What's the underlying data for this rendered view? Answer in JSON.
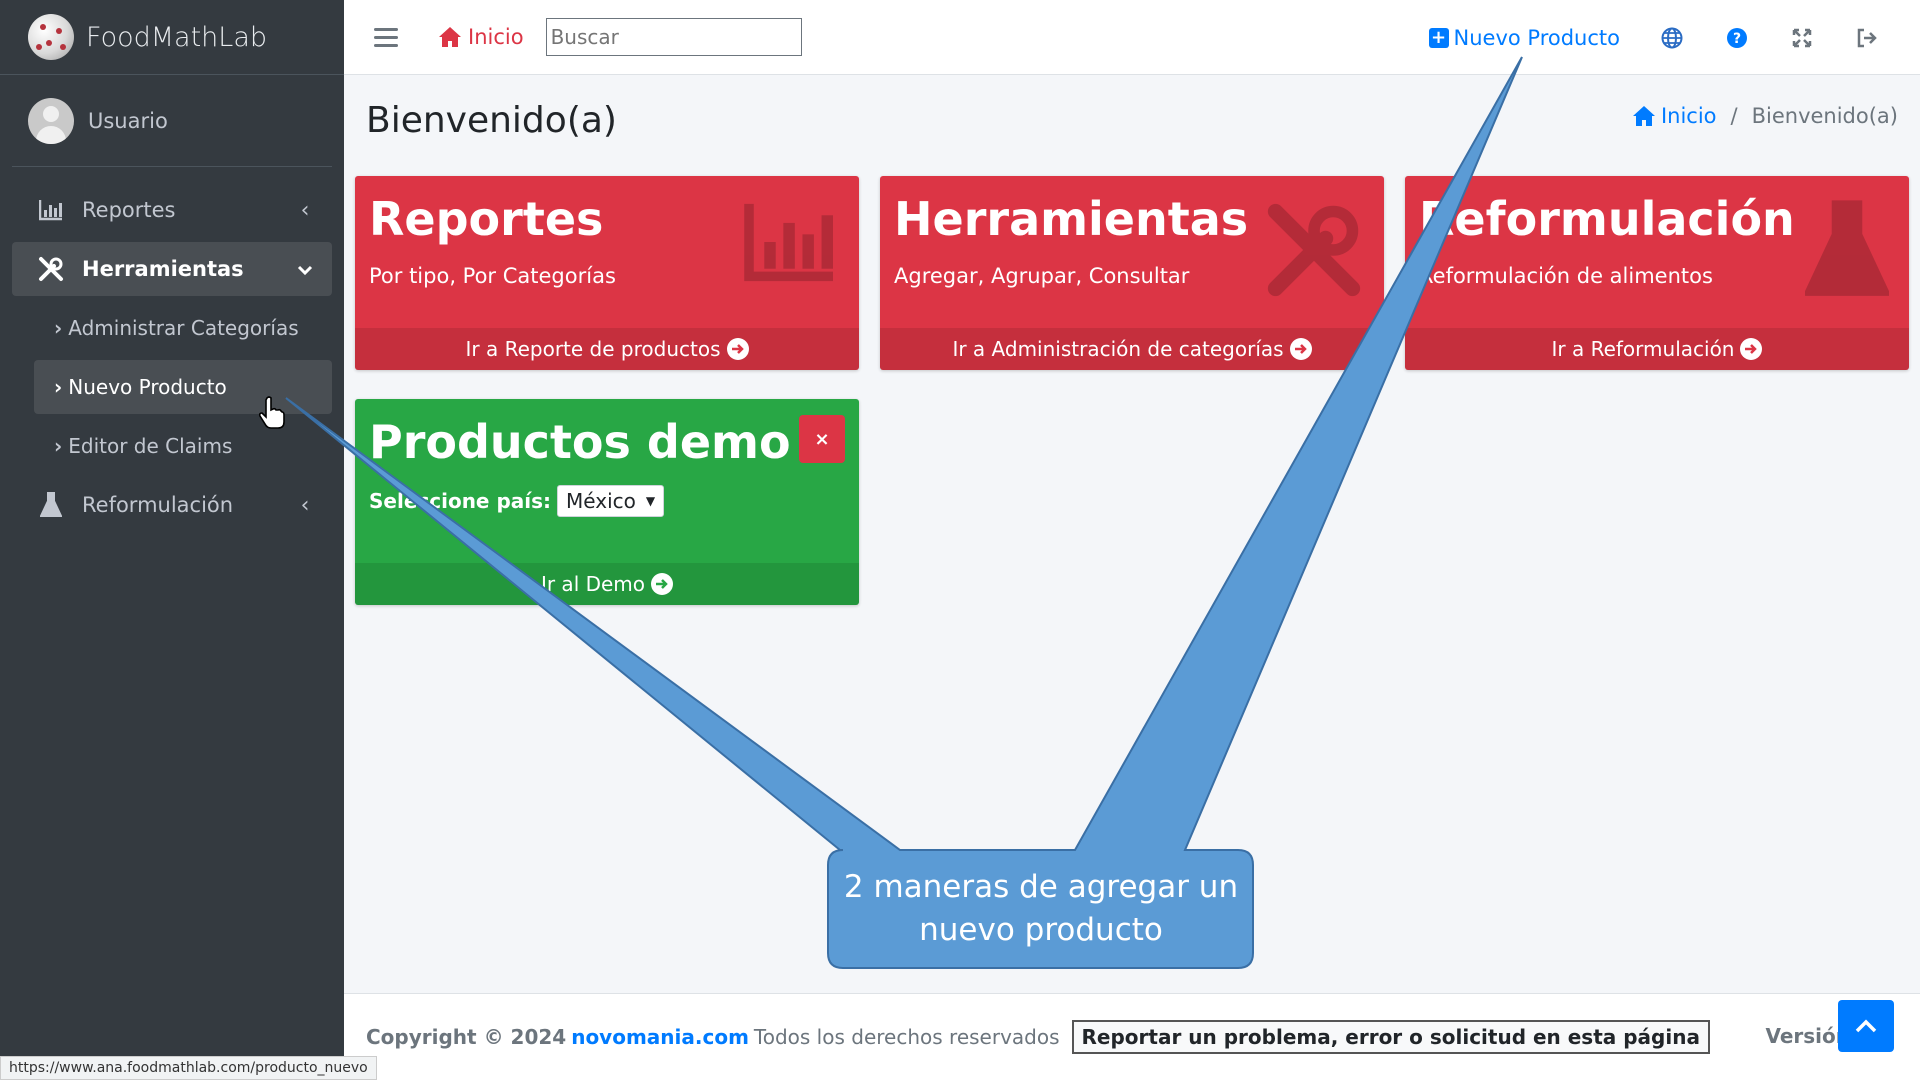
{
  "brand": {
    "name": "FoodMathLab"
  },
  "user": {
    "name": "Usuario"
  },
  "sidebar": {
    "items": [
      {
        "label": "Reportes",
        "icon": "bar-chart-icon",
        "arrow": "‹"
      },
      {
        "label": "Herramientas",
        "icon": "tools-icon",
        "arrow": "⌄"
      },
      {
        "label": "Reformulación",
        "icon": "flask-icon",
        "arrow": "‹"
      }
    ],
    "subitems": [
      {
        "label": "Administrar Categorías"
      },
      {
        "label": "Nuevo Producto"
      },
      {
        "label": "Editor de Claims"
      }
    ]
  },
  "header": {
    "home_label": "Inicio",
    "search_placeholder": "Buscar",
    "new_product_label": "Nuevo Producto"
  },
  "page": {
    "title": "Bienvenido(a)",
    "breadcrumb": {
      "home": "Inicio",
      "separator": "/",
      "current": "Bienvenido(a)"
    }
  },
  "cards": [
    {
      "title": "Reportes",
      "subtitle": "Por tipo, Por Categorías",
      "footer": "Ir a Reporte de productos"
    },
    {
      "title": "Herramientas",
      "subtitle": "Agregar, Agrupar, Consultar",
      "footer": "Ir a Administración de categorías"
    },
    {
      "title": "Reformulación",
      "subtitle": "Reformulación de alimentos",
      "footer": "Ir a Reformulación"
    }
  ],
  "demo_card": {
    "title": "Productos demo",
    "country_label": "Seleccione país:",
    "country_value": "México",
    "footer": "Ir al Demo",
    "close_label": "×"
  },
  "callout": {
    "text": "2 maneras de agregar un nuevo producto"
  },
  "footer": {
    "copyright": "Copyright © 2024",
    "site": "novomania.com",
    "rights": "Todos los derechos reservados",
    "report_button": "Reportar un problema, error o solicitud en esta página",
    "version": "Versión"
  },
  "statusbar": {
    "url": "https://www.ana.foodmathlab.com/producto_nuevo"
  },
  "colors": {
    "red": "#dc3545",
    "green": "#28a745",
    "blue": "#007bff",
    "sidebar": "#343a40",
    "callout": "#5b9bd5"
  }
}
